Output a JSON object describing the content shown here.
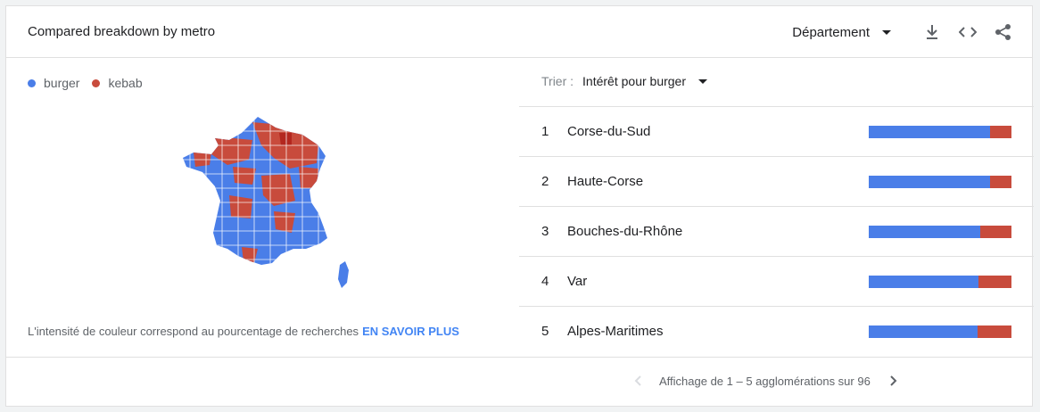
{
  "header": {
    "title": "Compared breakdown by metro",
    "region_label": "Département",
    "icons": [
      "download-icon",
      "embed-code-icon",
      "share-icon"
    ]
  },
  "legend": {
    "items": [
      {
        "label": "burger",
        "color": "#4a7ee8"
      },
      {
        "label": "kebab",
        "color": "#c84b3c"
      }
    ]
  },
  "map": {
    "colors": {
      "burger": "#4a7ee8",
      "kebab": "#c84b3c",
      "kebab_strong": "#b3271f"
    }
  },
  "note": {
    "text": "L'intensité de couleur correspond au pourcentage de recherches",
    "link": "EN SAVOIR PLUS"
  },
  "sort": {
    "label": "Trier :",
    "value": "Intérêt pour burger"
  },
  "rows": [
    {
      "rank": "1",
      "name": "Corse-du-Sud",
      "burger": 85,
      "kebab": 15
    },
    {
      "rank": "2",
      "name": "Haute-Corse",
      "burger": 85,
      "kebab": 15
    },
    {
      "rank": "3",
      "name": "Bouches-du-Rhône",
      "burger": 78,
      "kebab": 22
    },
    {
      "rank": "4",
      "name": "Var",
      "burger": 77,
      "kebab": 23
    },
    {
      "rank": "5",
      "name": "Alpes-Maritimes",
      "burger": 76,
      "kebab": 24
    }
  ],
  "pager": {
    "text": "Affichage de 1 – 5 agglomérations sur 96"
  }
}
